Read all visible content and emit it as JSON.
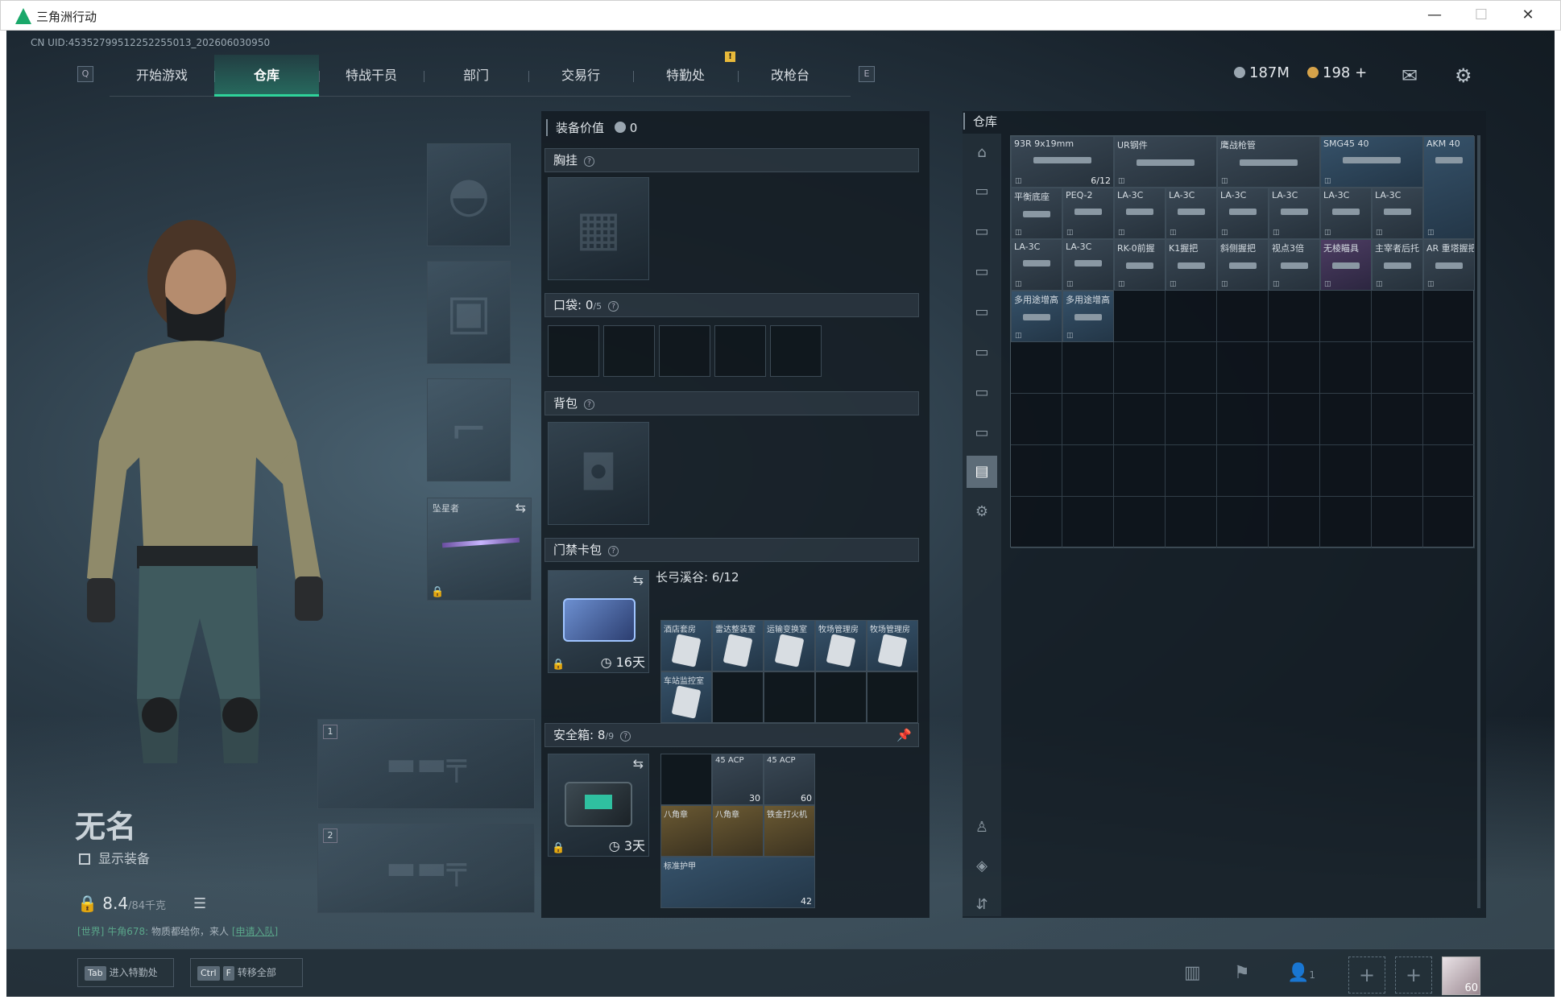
{
  "window": {
    "title": "三角洲行动"
  },
  "uid": "CN UID:453527995122522550​13_202606030950",
  "nav": {
    "key_left": "Q",
    "key_right": "E",
    "tabs": [
      "开始游戏",
      "仓库",
      "特战干员",
      "部门",
      "交易行",
      "特勤处",
      "改枪台"
    ],
    "active": 1,
    "alert": "!"
  },
  "currency": {
    "silver": "187M",
    "gold": "198",
    "gold_plus": "+"
  },
  "character": {
    "name": "无名",
    "show_equipment": "显示装备",
    "weight_value": "8.4",
    "weight_cap": "/84千克",
    "chat_channel": "[世界]",
    "chat_user": "牛角678:",
    "chat_text": "物质都给你，来人",
    "chat_link": "[申请入队]"
  },
  "melee": {
    "label": "坠星者"
  },
  "weapon_slots": [
    "1",
    "2"
  ],
  "loadout": {
    "value_label": "装备价值",
    "value": "0",
    "chest": "胸挂",
    "pockets_label": "口袋:",
    "pockets_used": "0",
    "pockets_total": "/5",
    "backpack": "背包",
    "keycard": "门禁卡包",
    "keycard_area": "长弓溪谷: 6/12",
    "keycard_days": "16天",
    "keycards": [
      "酒店套房",
      "雷达整装室",
      "运输变换室",
      "牧场管理房",
      "牧场管理房",
      "车站监控室"
    ],
    "safebox_label": "安全箱:",
    "safebox_used": "8",
    "safebox_total": "/9",
    "safebox_days": "3天",
    "safebox_items": [
      {
        "name": "45 ACP",
        "count": "30"
      },
      {
        "name": "45 ACP",
        "count": "60"
      },
      {
        "name": "八角章",
        "count": ""
      },
      {
        "name": "八角章",
        "count": ""
      },
      {
        "name": "铁金打火机",
        "count": ""
      },
      {
        "name": "标准护甲",
        "count": "42"
      }
    ]
  },
  "storage": {
    "title": "仓库",
    "items": [
      {
        "name": "93R 9x19mm",
        "count": "6/12"
      },
      {
        "name": "UR钢件"
      },
      {
        "name": "鹰战枪管"
      },
      {
        "name": "SMG45 40"
      },
      {
        "name": "AKM 40"
      },
      {
        "name": "平衡底座"
      },
      {
        "name": "PEQ-2"
      },
      {
        "name": "LA-3C"
      },
      {
        "name": "LA-3C"
      },
      {
        "name": "LA-3C"
      },
      {
        "name": "LA-3C"
      },
      {
        "name": "LA-3C"
      },
      {
        "name": "LA-3C"
      },
      {
        "name": "LA-3C"
      },
      {
        "name": "LA-3C"
      },
      {
        "name": "RK-0前握"
      },
      {
        "name": "K1握把"
      },
      {
        "name": "斜侧握把"
      },
      {
        "name": "视点3倍"
      },
      {
        "name": "无棱瞄具"
      },
      {
        "name": "主宰者后托"
      },
      {
        "name": "AR 重塔握把"
      },
      {
        "name": "多用途增高"
      },
      {
        "name": "多用途增高"
      }
    ]
  },
  "bottom": {
    "tab_key": "Tab",
    "tab_label": "进入特勤处",
    "ctrl_key": "Ctrl",
    "f_key": "F",
    "transfer_label": "转移全部",
    "squad_count": "1",
    "level": "60"
  },
  "colors": {
    "accent": "#2fd39a",
    "panel": "#141c23"
  }
}
